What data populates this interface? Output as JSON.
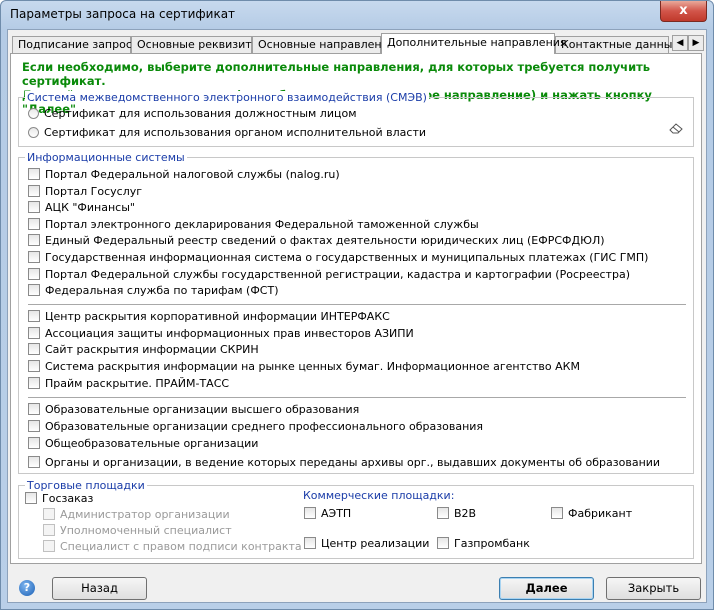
{
  "window": {
    "title": "Параметры запроса на сертификат",
    "close_label": "x"
  },
  "tabs": [
    {
      "label": "Подписание запроса"
    },
    {
      "label": "Основные реквизиты"
    },
    {
      "label": "Основные направления"
    },
    {
      "label": "Дополнительные направления",
      "active": true
    },
    {
      "label": "Контактные данные"
    }
  ],
  "tab_scroll": {
    "left": "◀",
    "right": "▶"
  },
  "notice": {
    "line1": "Если необходимо, выберите дополнительные направления, для которых требуется получить сертификат.",
    "line2": "Данный шаг можно пропустить (не выбирать дополнительное направление) и нажать кнопку \"Далее\""
  },
  "smev": {
    "legend": "Система межведомственного электронного взаимодействия (СМЭВ)",
    "options": [
      "Сертификат для использования должностным лицом",
      "Сертификат для использования органом исполнительной власти"
    ],
    "clear_icon": "eraser-icon"
  },
  "info_systems": {
    "legend": "Информационные системы",
    "group1": [
      "Портал Федеральной налоговой службы (nalog.ru)",
      "Портал Госуслуг",
      "АЦК \"Финансы\"",
      "Портал электронного декларирования Федеральной таможенной службы",
      "Единый Федеральный реестр сведений о фактах деятельности юридических лиц (ЕФРСФДЮЛ)",
      "Государственная информационная система о государственных и муниципальных платежах (ГИС ГМП)",
      "Портал Федеральной службы государственной регистрации, кадастра и картографии (Росреестра)",
      "Федеральная служба по тарифам (ФСТ)"
    ],
    "group2": [
      "Центр раскрытия корпоративной информации ИНТЕРФАКС",
      "Ассоциация защиты информационных прав инвесторов АЗИПИ",
      "Сайт раскрытия информации СКРИН",
      "Система раскрытия информации на рынке ценных бумаг. Информационное агентство АКМ",
      "Прайм раскрытие. ПРАЙМ-ТАСС"
    ],
    "group3": [
      "Образовательные организации высшего образования",
      "Образовательные организации среднего профессионального образования",
      "Общеобразовательные организации",
      "Органы и организации, в ведение которых переданы архивы орг., выдавших документы об образовании"
    ]
  },
  "trading": {
    "legend": "Торговые площадки",
    "goszakaz": "Госзаказ",
    "sub": [
      "Администратор организации",
      "Уполномоченный специалист",
      "Специалист с правом подписи контракта"
    ],
    "commercial_legend": "Коммерческие площадки:",
    "commercial": [
      "АЭТП",
      "B2B",
      "Фабрикант",
      "Центр реализации",
      "Газпромбанк"
    ]
  },
  "buttons": {
    "help": "?",
    "back": "Назад",
    "next": "Далее",
    "close": "Закрыть"
  }
}
